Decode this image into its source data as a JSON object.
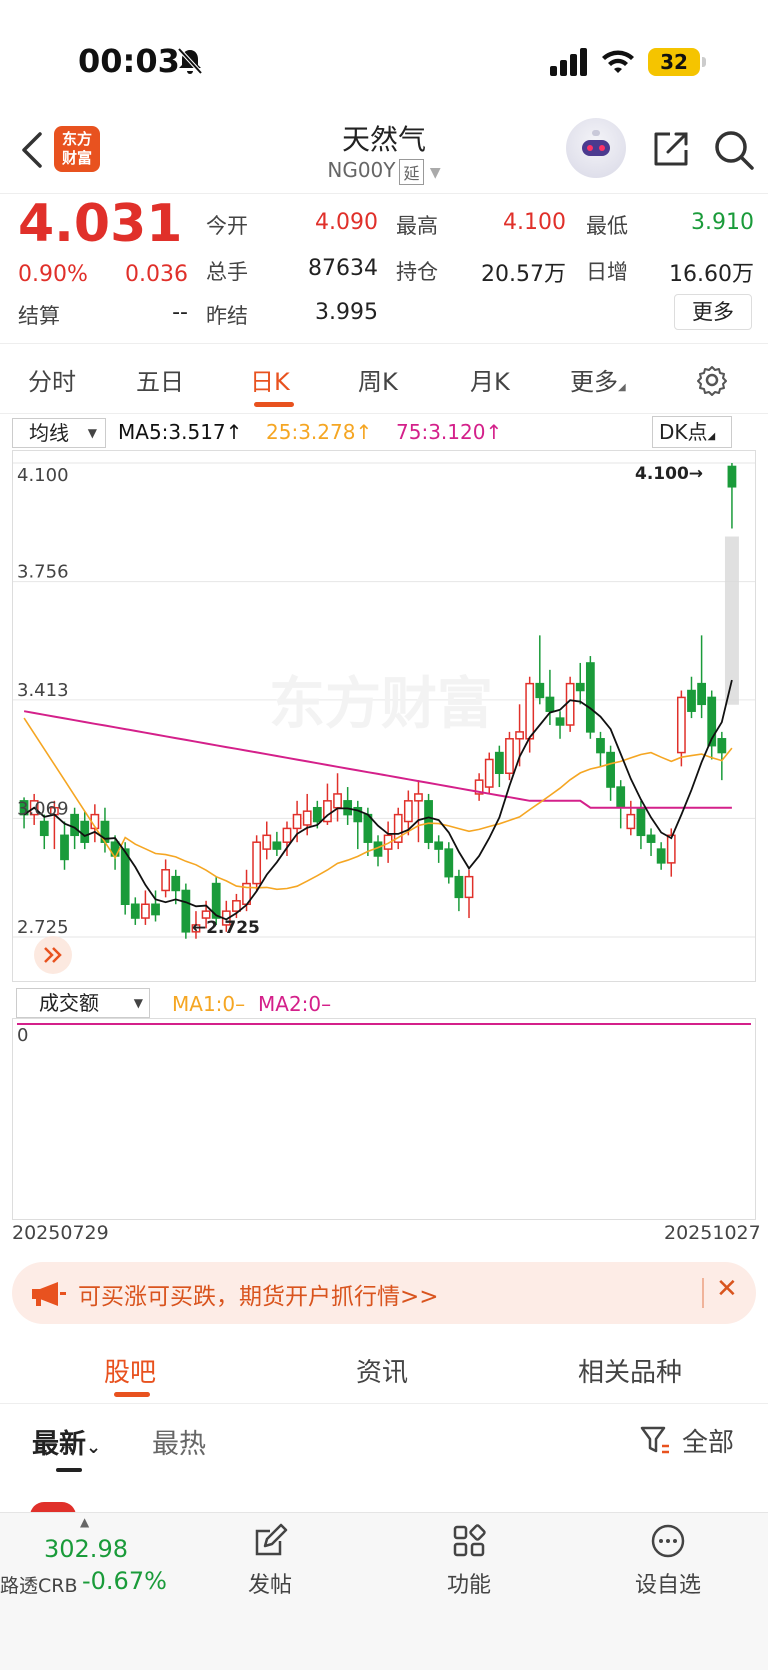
{
  "status": {
    "time": "00:03",
    "battery": "32"
  },
  "nav": {
    "title": "天然气",
    "code": "NG00Y",
    "delay_tag": "延",
    "logo_line1": "东方",
    "logo_line2": "财富"
  },
  "quote": {
    "price": "4.031",
    "change_pct": "0.90%",
    "change": "0.036",
    "fields": [
      {
        "label": "今开",
        "value": "4.090",
        "color": "#e0302a"
      },
      {
        "label": "最高",
        "value": "4.100",
        "color": "#e0302a"
      },
      {
        "label": "最低",
        "value": "3.910",
        "color": "#1a9b3a"
      },
      {
        "label": "总手",
        "value": "87634",
        "color": "#222222"
      },
      {
        "label": "持仓",
        "value": "20.57万",
        "color": "#222222"
      },
      {
        "label": "日增",
        "value": "16.60万",
        "color": "#222222"
      },
      {
        "label": "结算",
        "value": "--",
        "color": "#222222"
      },
      {
        "label": "昨结",
        "value": "3.995",
        "color": "#222222"
      }
    ],
    "more_button": "更多"
  },
  "tabs": [
    "分时",
    "五日",
    "日K",
    "周K",
    "月K",
    "更多"
  ],
  "active_tab": "日K",
  "indicator": {
    "selector": "均线",
    "ma5": "MA5:3.517",
    "ma25": "25:3.278",
    "ma75": "75:3.120",
    "dk": "DK点"
  },
  "chart_data": {
    "type": "candlestick",
    "y_ticks": [
      "4.100",
      "3.756",
      "3.413",
      "3.069",
      "2.725"
    ],
    "ylim": [
      2.725,
      4.1
    ],
    "high_marker": "4.100",
    "low_marker": "2.725",
    "x_start": "20250729",
    "x_end": "20251027",
    "candles": [
      [
        3.12,
        3.08,
        3.13,
        3.04
      ],
      [
        3.08,
        3.12,
        3.14,
        3.05
      ],
      [
        3.06,
        3.02,
        3.08,
        2.98
      ],
      [
        3.08,
        3.1,
        3.12,
        2.98
      ],
      [
        3.02,
        2.95,
        3.06,
        2.92
      ],
      [
        3.08,
        3.02,
        3.1,
        2.98
      ],
      [
        3.06,
        3.0,
        3.09,
        2.98
      ],
      [
        3.04,
        3.08,
        3.11,
        3.0
      ],
      [
        3.06,
        3.0,
        3.1,
        2.97
      ],
      [
        3.0,
        2.96,
        3.02,
        2.92
      ],
      [
        2.98,
        2.82,
        3.0,
        2.79
      ],
      [
        2.82,
        2.78,
        2.84,
        2.76
      ],
      [
        2.78,
        2.82,
        2.86,
        2.76
      ],
      [
        2.82,
        2.79,
        2.86,
        2.77
      ],
      [
        2.86,
        2.92,
        2.95,
        2.84
      ],
      [
        2.9,
        2.86,
        2.92,
        2.82
      ],
      [
        2.86,
        2.74,
        2.88,
        2.72
      ],
      [
        2.74,
        2.76,
        2.8,
        2.72
      ],
      [
        2.78,
        2.8,
        2.83,
        2.75
      ],
      [
        2.88,
        2.78,
        2.9,
        2.76
      ],
      [
        2.76,
        2.8,
        2.83,
        2.74
      ],
      [
        2.8,
        2.83,
        2.85,
        2.78
      ],
      [
        2.82,
        2.88,
        2.92,
        2.8
      ],
      [
        2.88,
        3.0,
        3.02,
        2.86
      ],
      [
        2.98,
        3.02,
        3.06,
        2.95
      ],
      [
        3.0,
        2.98,
        3.03,
        2.96
      ],
      [
        3.0,
        3.04,
        3.06,
        2.96
      ],
      [
        3.04,
        3.08,
        3.12,
        3.0
      ],
      [
        3.05,
        3.09,
        3.14,
        3.02
      ],
      [
        3.1,
        3.06,
        3.12,
        3.04
      ],
      [
        3.06,
        3.12,
        3.17,
        3.05
      ],
      [
        3.1,
        3.14,
        3.2,
        3.06
      ],
      [
        3.12,
        3.08,
        3.16,
        3.05
      ],
      [
        3.1,
        3.06,
        3.12,
        2.98
      ],
      [
        3.08,
        3.0,
        3.1,
        2.96
      ],
      [
        3.0,
        2.96,
        3.02,
        2.93
      ],
      [
        2.98,
        3.02,
        3.06,
        2.94
      ],
      [
        3.0,
        3.08,
        3.1,
        2.98
      ],
      [
        3.06,
        3.12,
        3.15,
        3.02
      ],
      [
        3.12,
        3.14,
        3.18,
        3.0
      ],
      [
        3.12,
        3.0,
        3.14,
        2.98
      ],
      [
        3.0,
        2.98,
        3.02,
        2.94
      ],
      [
        2.98,
        2.9,
        3.0,
        2.88
      ],
      [
        2.9,
        2.84,
        2.92,
        2.8
      ],
      [
        2.84,
        2.9,
        2.92,
        2.78
      ],
      [
        3.14,
        3.18,
        3.2,
        3.12
      ],
      [
        3.16,
        3.24,
        3.26,
        3.14
      ],
      [
        3.26,
        3.2,
        3.28,
        3.16
      ],
      [
        3.2,
        3.3,
        3.32,
        3.18
      ],
      [
        3.3,
        3.32,
        3.4,
        3.22
      ],
      [
        3.3,
        3.46,
        3.48,
        3.26
      ],
      [
        3.46,
        3.42,
        3.6,
        3.4
      ],
      [
        3.42,
        3.38,
        3.5,
        3.34
      ],
      [
        3.36,
        3.34,
        3.38,
        3.3
      ],
      [
        3.34,
        3.46,
        3.48,
        3.32
      ],
      [
        3.46,
        3.44,
        3.52,
        3.4
      ],
      [
        3.52,
        3.32,
        3.54,
        3.3
      ],
      [
        3.3,
        3.26,
        3.32,
        3.22
      ],
      [
        3.26,
        3.16,
        3.28,
        3.12
      ],
      [
        3.16,
        3.1,
        3.18,
        3.04
      ],
      [
        3.04,
        3.08,
        3.12,
        3.02
      ],
      [
        3.1,
        3.02,
        3.12,
        2.98
      ],
      [
        3.02,
        3.0,
        3.04,
        2.96
      ],
      [
        2.98,
        2.94,
        3.0,
        2.92
      ],
      [
        2.94,
        3.02,
        3.04,
        2.9
      ],
      [
        3.26,
        3.42,
        3.44,
        3.22
      ],
      [
        3.44,
        3.38,
        3.48,
        3.36
      ],
      [
        3.46,
        3.4,
        3.6,
        3.36
      ],
      [
        3.42,
        3.28,
        3.44,
        3.24
      ],
      [
        3.3,
        3.26,
        3.32,
        3.18
      ],
      [
        4.09,
        4.031,
        4.1,
        3.91
      ]
    ]
  },
  "volume": {
    "selector": "成交额",
    "ma1": "MA1:0–",
    "ma2": "MA2:0–",
    "zero": "0"
  },
  "banner": {
    "text": "可买涨可买跌，期货开户抓行情>>"
  },
  "bottom_tabs": [
    "股吧",
    "资讯",
    "相关品种"
  ],
  "active_bottom_tab": "股吧",
  "filter": {
    "latest": "最新",
    "hot": "最热",
    "all": "全部"
  },
  "dock": {
    "index_value": "302.98",
    "index_name": "路透CRB",
    "index_pct": "-0.67%",
    "post": "发帖",
    "function": "功能",
    "watchlist": "设自选"
  },
  "colors": {
    "up": "#e0302a",
    "down": "#1a9b3a",
    "ma5": "#111111",
    "ma25": "#f5a623",
    "ma75": "#d4208a",
    "accent": "#e8521f"
  }
}
